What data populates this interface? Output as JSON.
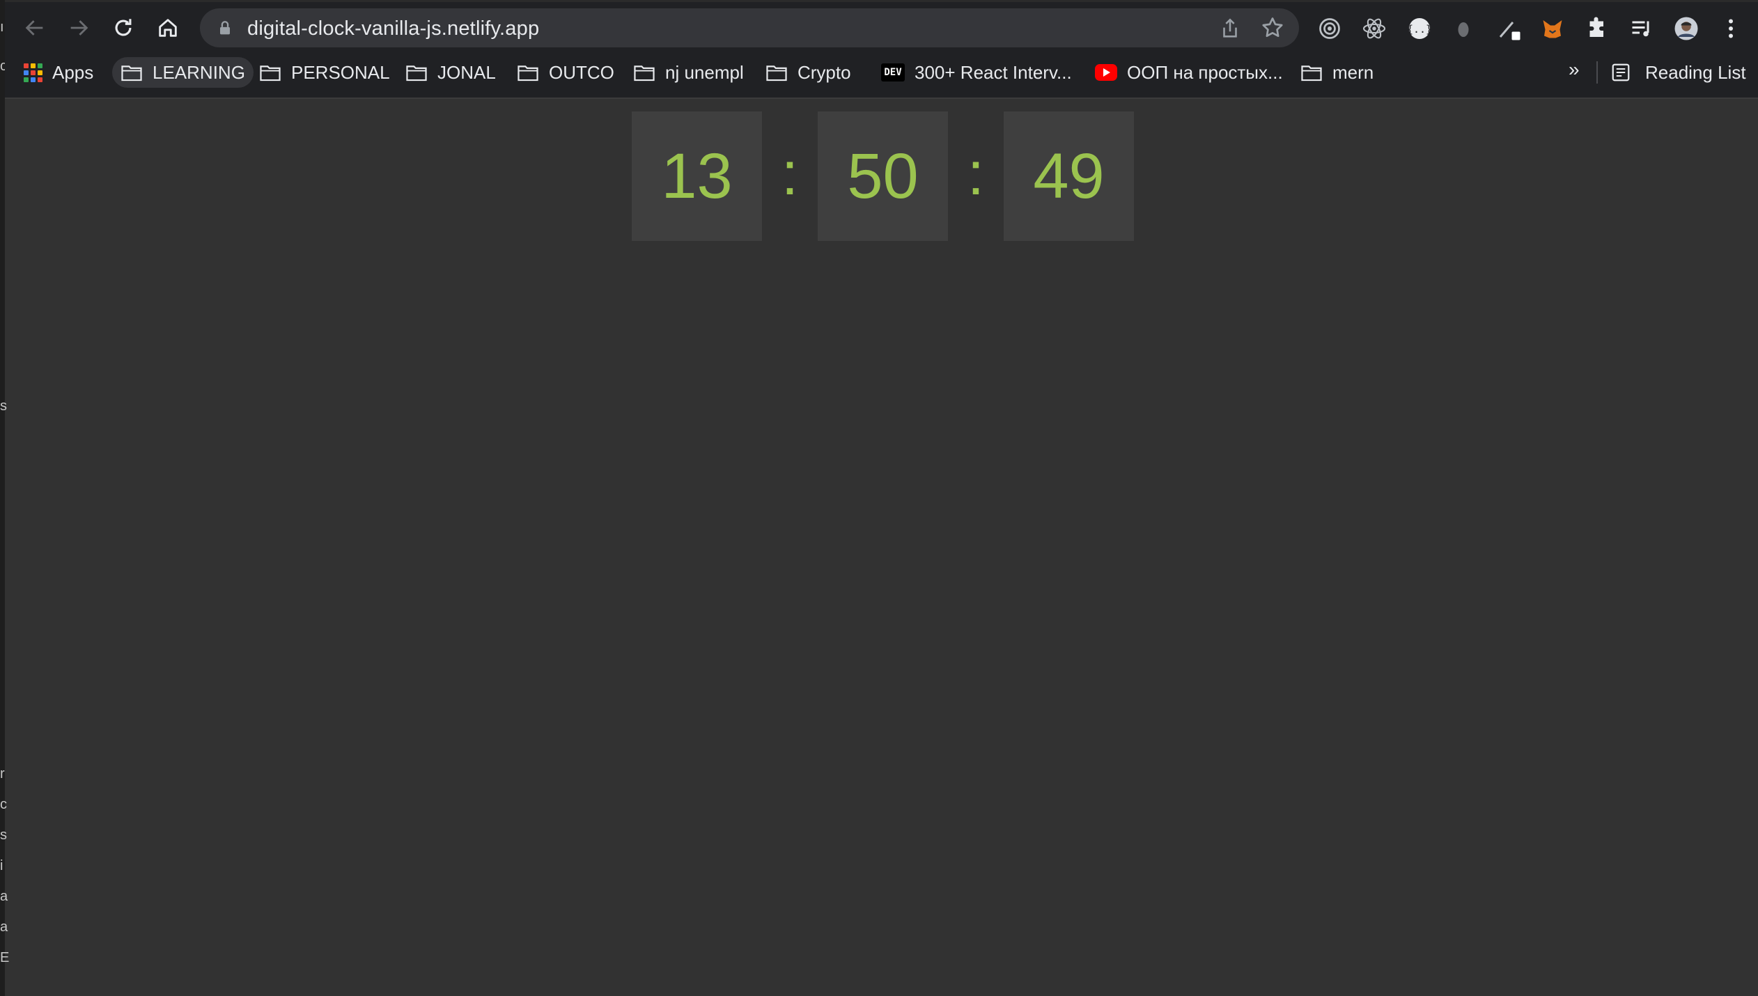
{
  "browser": {
    "url": "digital-clock-vanilla-js.netlify.app"
  },
  "bookmarks": [
    {
      "label": "Apps",
      "icon": "apps-grid-icon"
    },
    {
      "label": "LEARNING",
      "icon": "folder-icon"
    },
    {
      "label": "PERSONAL",
      "icon": "folder-icon"
    },
    {
      "label": "JONAL",
      "icon": "folder-icon"
    },
    {
      "label": "OUTCO",
      "icon": "folder-icon"
    },
    {
      "label": "nj unempl",
      "icon": "folder-icon"
    },
    {
      "label": "Crypto",
      "icon": "folder-icon"
    },
    {
      "label": "300+ React Interv...",
      "icon": "dev-icon",
      "badge": "DEV"
    },
    {
      "label": "ООП на простых...",
      "icon": "youtube-icon"
    },
    {
      "label": "mern",
      "icon": "folder-icon"
    }
  ],
  "overflow_label": "»",
  "reading_list_label": "Reading List",
  "clock": {
    "hours": "13",
    "minutes": "50",
    "seconds": "49",
    "separator": ":"
  },
  "colors": {
    "page_bg": "#323232",
    "digit_box_bg": "#3f3f3f",
    "digit_color": "#9bc34f",
    "chrome_bg": "#202124"
  },
  "gutter_text": [
    "ı",
    "c",
    "s",
    "r",
    "c",
    "s",
    "i",
    "a",
    "a",
    "E"
  ]
}
